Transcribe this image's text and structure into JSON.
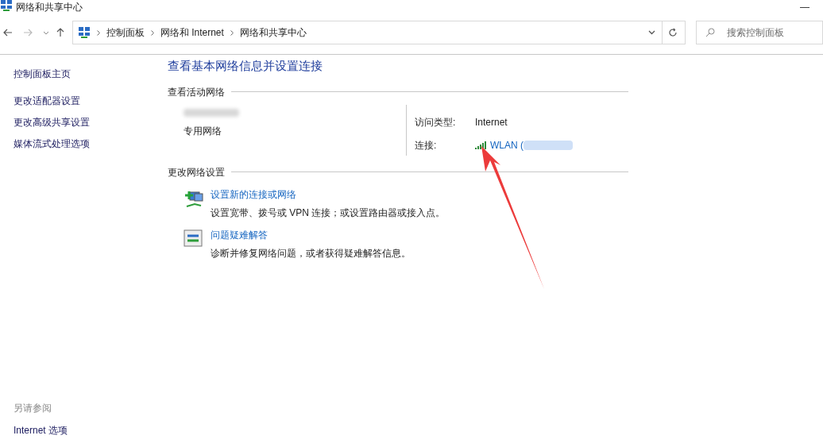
{
  "window": {
    "title": "网络和共享中心",
    "minimize": "—"
  },
  "address_bar": {
    "breadcrumbs": [
      "控制面板",
      "网络和 Internet",
      "网络和共享中心"
    ]
  },
  "search": {
    "placeholder": "搜索控制面板"
  },
  "sidebar": {
    "items": [
      {
        "label": "控制面板主页"
      },
      {
        "label": "更改适配器设置"
      },
      {
        "label": "更改高级共享设置"
      },
      {
        "label": "媒体流式处理选项"
      }
    ],
    "see_also": {
      "heading": "另请参阅",
      "links": [
        "Internet 选项"
      ]
    }
  },
  "main": {
    "title": "查看基本网络信息并设置连接",
    "active_networks": {
      "heading": "查看活动网络",
      "network_type": "专用网络",
      "access_type_label": "访问类型:",
      "access_type": "Internet",
      "connection_label": "连接:",
      "connection": "WLAN ("
    },
    "change_settings": {
      "heading": "更改网络设置",
      "tasks": [
        {
          "kind": "new-connection",
          "title": "设置新的连接或网络",
          "description": "设置宽带、拨号或 VPN 连接；或设置路由器或接入点。"
        },
        {
          "kind": "troubleshoot",
          "title": "问题疑难解答",
          "description": "诊断并修复网络问题，或者获得疑难解答信息。"
        }
      ]
    }
  }
}
